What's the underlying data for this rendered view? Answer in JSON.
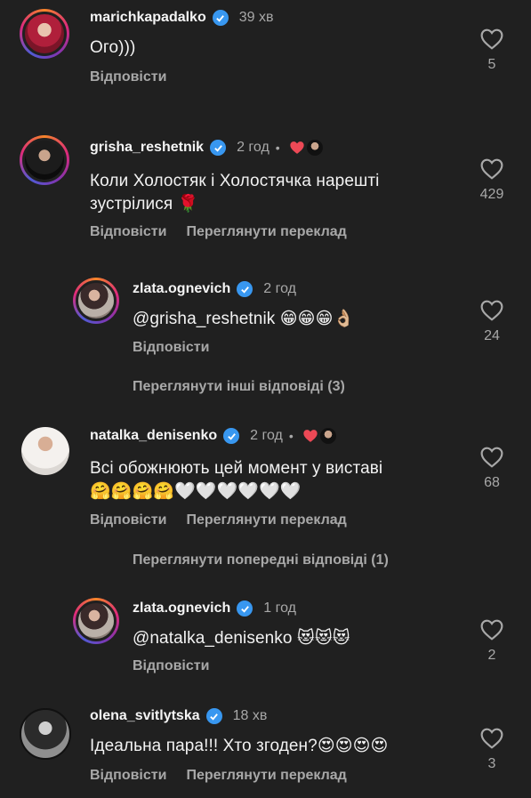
{
  "comments": [
    {
      "username": "marichkapadalko",
      "time": "39 хв",
      "text": "Ого)))",
      "likes": "5",
      "reply": "Відповісти"
    },
    {
      "username": "grisha_reshetnik",
      "time": "2 год",
      "dot": "•",
      "text_line1": "Коли Холостяк і Холостячка нарешті",
      "text_line2": "зустрілися 🌹",
      "likes": "429",
      "reply": "Відповісти",
      "translate": "Переглянути переклад"
    },
    {
      "username": "zlata.ognevich",
      "time": "2 год",
      "text": "@grisha_reshetnik 😁😁😁👌🏼",
      "likes": "24",
      "reply": "Відповісти"
    },
    {
      "username": "natalka_denisenko",
      "time": "2 год",
      "dot": "•",
      "text_line1": "Всі обожнюють цей момент у виставі",
      "text_line2": "🤗🤗🤗🤗🤍🤍🤍🤍🤍🤍",
      "likes": "68",
      "reply": "Відповісти",
      "translate": "Переглянути переклад"
    },
    {
      "username": "zlata.ognevich",
      "time": "1 год",
      "text": "@natalka_denisenko 😻😻😻",
      "likes": "2",
      "reply": "Відповісти"
    },
    {
      "username": "olena_svitlytska",
      "time": "18 хв",
      "text": "Ідеальна пара!!! Хто згоден?😍😍😍😍",
      "likes": "3",
      "reply": "Відповісти",
      "translate": "Переглянути переклад"
    }
  ],
  "links": {
    "other_replies": "Переглянути інші відповіді (3)",
    "previous_replies": "Переглянути попередні відповіді (1)"
  },
  "colors": {
    "background": "#202020",
    "secondary_text": "#a8a8a8",
    "verified": "#3897f0",
    "liked_heart": "#ed4956"
  }
}
